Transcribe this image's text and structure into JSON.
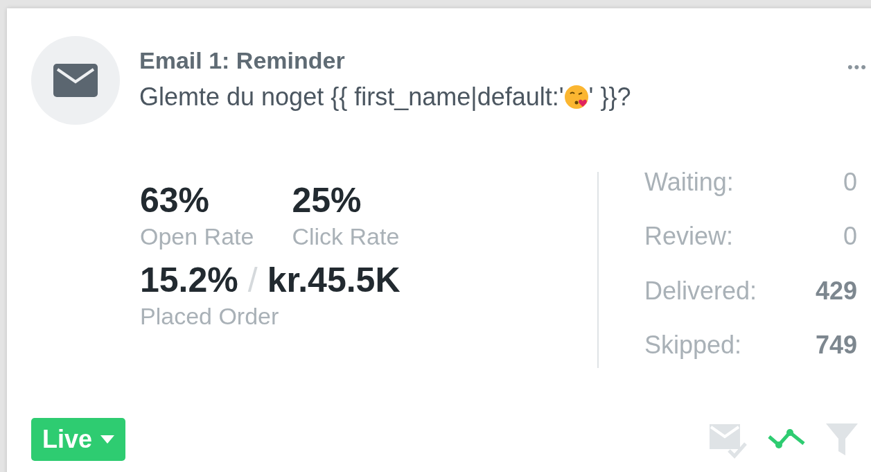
{
  "card": {
    "title": "Email 1: Reminder",
    "subject_before": "Glemte du noget {{ first_name|default:'",
    "subject_after": "' }}?",
    "menu": "•••"
  },
  "metrics": [
    {
      "kind": "pair",
      "values": [
        {
          "value": "63%",
          "label": "Open Rate"
        },
        {
          "value": "25%",
          "label": "Click Rate"
        }
      ]
    },
    {
      "kind": "order",
      "value": "15.2%",
      "separator": "/",
      "revenue": "kr.45.5K",
      "label": "Placed Order"
    }
  ],
  "stats": [
    {
      "label": "Waiting:",
      "value": "0",
      "bold": false
    },
    {
      "label": "Review:",
      "value": "0",
      "bold": false
    },
    {
      "label": "Delivered:",
      "value": "429",
      "bold": true
    },
    {
      "label": "Skipped:",
      "value": "749",
      "bold": true
    }
  ],
  "status": {
    "label": "Live"
  }
}
